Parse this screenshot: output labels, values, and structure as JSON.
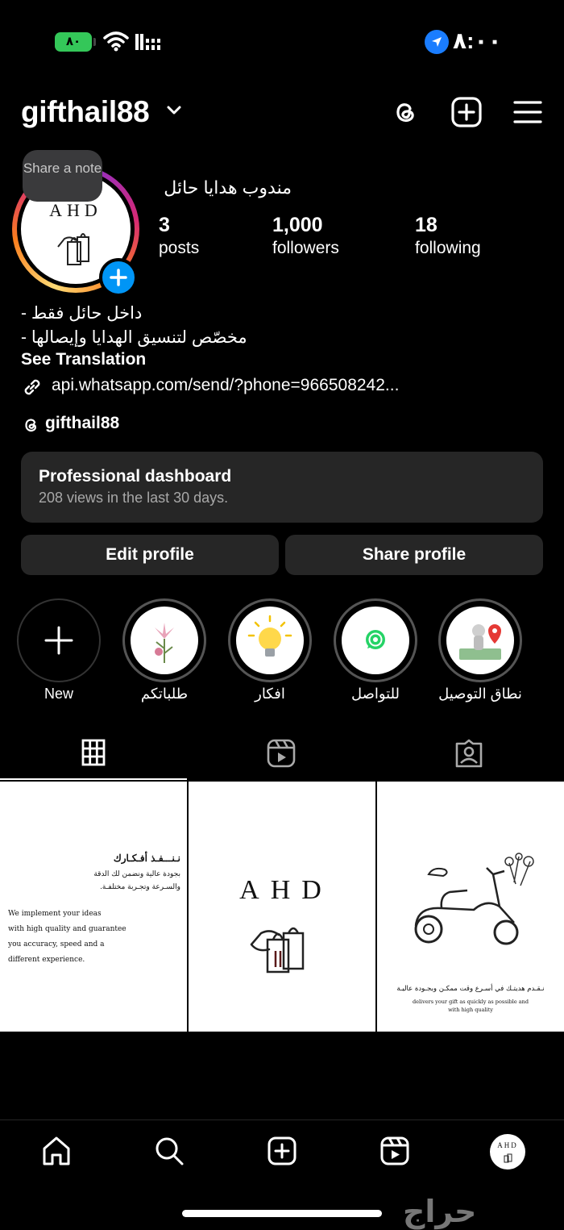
{
  "status_bar": {
    "time": "٨:٠٠",
    "battery": "٨٠"
  },
  "header": {
    "username": "gifthail88"
  },
  "profile": {
    "note_bubble": "Share a note",
    "avatar_logo": "AHD",
    "display_name": "مندوب هدايا حائل",
    "stats": [
      {
        "value": "3",
        "label": "posts"
      },
      {
        "value": "1,000",
        "label": "followers"
      },
      {
        "value": "18",
        "label": "following"
      }
    ],
    "bio": [
      "داخل حائل فقط -",
      "مخصّص لتنسيق الهدايا وإيصالها -"
    ],
    "see_translation": "See Translation",
    "link": "api.whatsapp.com/send/?phone=966508242...",
    "threads_handle": "gifthail88"
  },
  "dashboard": {
    "title": "Professional dashboard",
    "subtitle": "208 views in the last 30 days."
  },
  "buttons": {
    "edit": "Edit profile",
    "share": "Share profile"
  },
  "highlights": [
    {
      "label": "New"
    },
    {
      "label": "طلباتكم"
    },
    {
      "label": "افكار"
    },
    {
      "label": "للتواصل"
    },
    {
      "label": "نطاق التوصيل"
    }
  ],
  "posts": {
    "post1": {
      "ar_title": "نـنـــفـذ أفـكـارك",
      "ar_line1": "بجودة عالية ونضمن لك الدقة",
      "ar_line2": "والسـرعة وتجـربة مختلفـة.",
      "en_lines": [
        "We implement your ideas",
        "with high quality and guarantee",
        "you accuracy, speed and a",
        "different experience."
      ]
    },
    "post2": {
      "logo": "AHD"
    },
    "post3": {
      "ar": "نـقـدم هديتـك في أسـرع وقت ممكـن وبجـودة عاليـة",
      "en1": "delivers your gift as quickly as possible and",
      "en2": "with high quality"
    }
  },
  "bottom_nav_avatar": "AHD",
  "watermark": "حراج"
}
